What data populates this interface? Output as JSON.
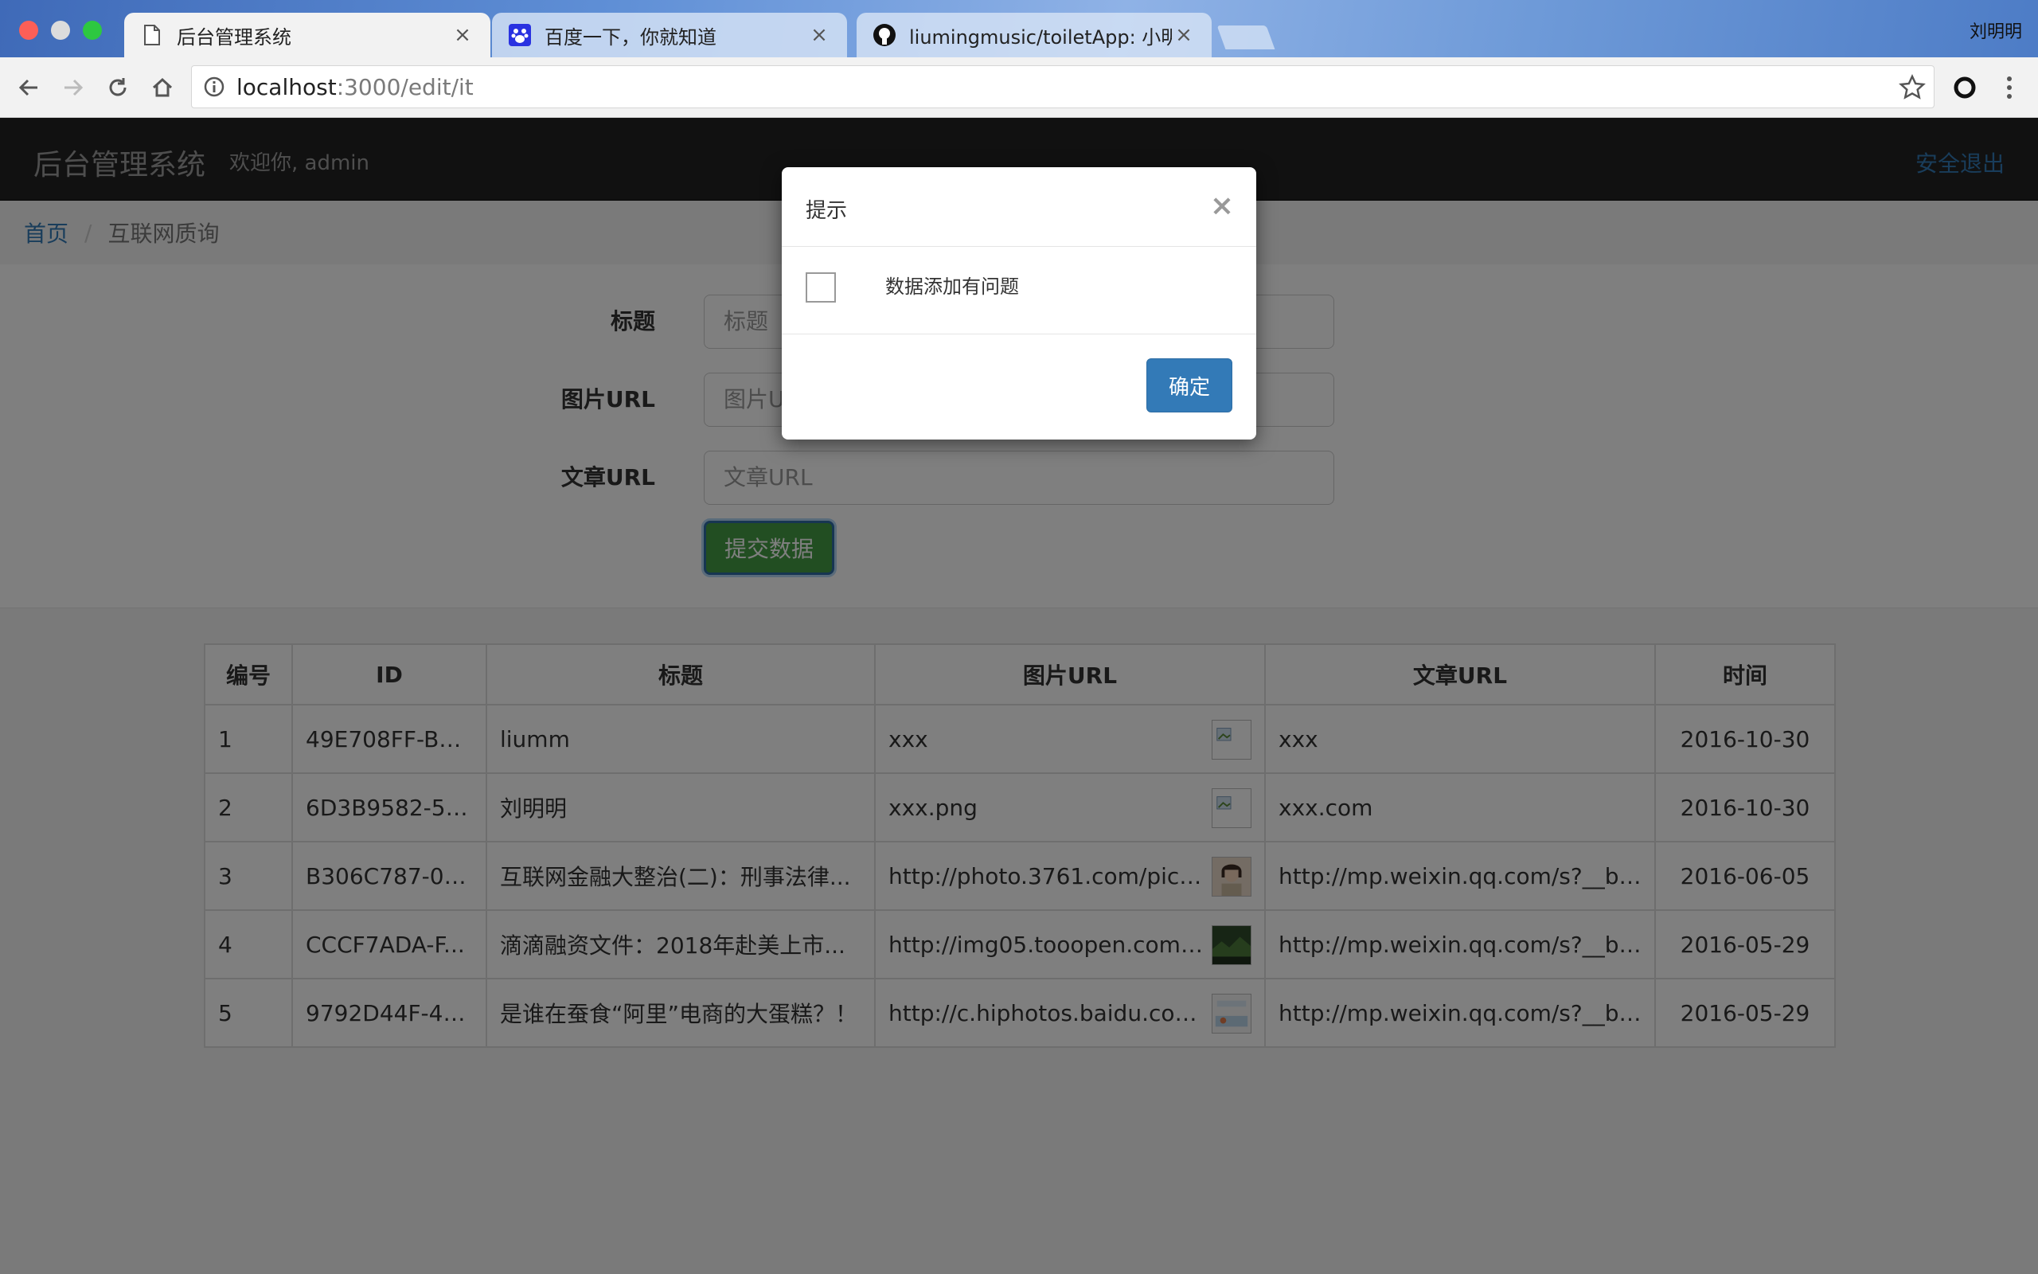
{
  "browser": {
    "tabs": [
      {
        "title": "后台管理系统",
        "icon": "document-icon"
      },
      {
        "title": "百度一下，你就知道",
        "icon": "baidu-paw-icon"
      },
      {
        "title": "liumingmusic/toiletApp: 小明带",
        "icon": "github-icon"
      }
    ],
    "profile_name": "刘明明",
    "url_host": "localhost",
    "url_path": ":3000/edit/it"
  },
  "app": {
    "brand": "后台管理系统",
    "welcome": "欢迎你, admin",
    "logout": "安全退出"
  },
  "breadcrumb": {
    "home": "首页",
    "separator": "/",
    "current": "互联网质询"
  },
  "form": {
    "title_label": "标题",
    "title_placeholder": "标题",
    "image_label": "图片URL",
    "image_placeholder": "图片URL",
    "article_label": "文章URL",
    "article_placeholder": "文章URL",
    "submit": "提交数据"
  },
  "table": {
    "headers": [
      "编号",
      "ID",
      "标题",
      "图片URL",
      "文章URL",
      "时间"
    ],
    "rows": [
      {
        "num": "1",
        "id": "49E708FF-B5...",
        "title": "liumm",
        "image": "xxx",
        "article": "xxx",
        "date": "2016-10-30"
      },
      {
        "num": "2",
        "id": "6D3B9582-5A...",
        "title": "刘明明",
        "image": "xxx.png",
        "article": "xxx.com",
        "date": "2016-10-30"
      },
      {
        "num": "3",
        "id": "B306C787-01...",
        "title": "互联网金融大整治(二)：刑事法律...",
        "image": "http://photo.3761.com/pictur...",
        "article": "http://mp.weixin.qq.com/s?__biz=...",
        "date": "2016-06-05"
      },
      {
        "num": "4",
        "id": "CCCF7ADA-F...",
        "title": "滴滴融资文件：2018年赴美上市...",
        "image": "http://img05.tooopen.com/im...",
        "article": "http://mp.weixin.qq.com/s?__biz=...",
        "date": "2016-05-29"
      },
      {
        "num": "5",
        "id": "9792D44F-4D...",
        "title": "是谁在蚕食“阿里”电商的大蛋糕？！",
        "image": "http://c.hiphotos.baidu.com/i...",
        "article": "http://mp.weixin.qq.com/s?__biz=...",
        "date": "2016-05-29"
      }
    ]
  },
  "modal": {
    "title": "提示",
    "close": "×",
    "message": "数据添加有问题",
    "ok": "确定"
  },
  "colors": {
    "navbar": "#222222",
    "link": "#337ab7",
    "primary": "#337ab7",
    "success": "#449d44"
  }
}
